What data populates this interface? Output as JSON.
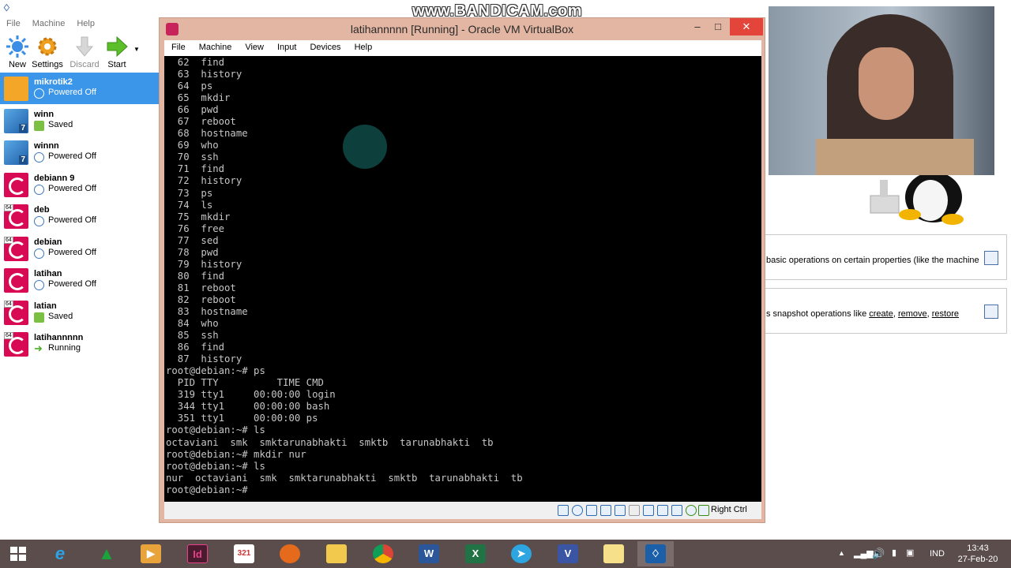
{
  "watermark": "www.BANDICAM.com",
  "manager": {
    "menu": [
      "File",
      "Machine",
      "Help"
    ],
    "toolbar": {
      "new": "New",
      "settings": "Settings",
      "discard": "Discard",
      "start": "Start"
    },
    "vms": [
      {
        "name": "mikrotik2",
        "state": "Powered Off",
        "os": "mikrotik",
        "selected": true
      },
      {
        "name": "winn",
        "state": "Saved",
        "os": "win7"
      },
      {
        "name": "winnn",
        "state": "Powered Off",
        "os": "win7"
      },
      {
        "name": "debiann 9",
        "state": "Powered Off",
        "os": "debian"
      },
      {
        "name": "deb",
        "state": "Powered Off",
        "os": "debian64"
      },
      {
        "name": "debian",
        "state": "Powered Off",
        "os": "debian64"
      },
      {
        "name": "latihan",
        "state": "Powered Off",
        "os": "debian"
      },
      {
        "name": "latian",
        "state": "Saved",
        "os": "debian64"
      },
      {
        "name": "latihannnnn",
        "state": "Running",
        "os": "debian64"
      }
    ],
    "details_pane": "basic operations on certain properties (like the machine",
    "snapshot_pane": {
      "prefix": "s snapshot operations like ",
      "create": "create",
      "sep1": ", ",
      "remove": "remove",
      "sep2": ", ",
      "restore": "restore"
    }
  },
  "vm_window": {
    "title": "latihannnnn [Running] - Oracle VM VirtualBox",
    "menu": [
      "File",
      "Machine",
      "View",
      "Input",
      "Devices",
      "Help"
    ],
    "terminal": "  62  find\n  63  history\n  64  ps\n  65  mkdir\n  66  pwd\n  67  reboot\n  68  hostname\n  69  who\n  70  ssh\n  71  find\n  72  history\n  73  ps\n  74  ls\n  75  mkdir\n  76  free\n  77  sed\n  78  pwd\n  79  history\n  80  find\n  81  reboot\n  82  reboot\n  83  hostname\n  84  who\n  85  ssh\n  86  find\n  87  history\nroot@debian:~# ps\n  PID TTY          TIME CMD\n  319 tty1     00:00:00 login\n  344 tty1     00:00:00 bash\n  351 tty1     00:00:00 ps\nroot@debian:~# ls\noctaviani  smk  smktarunabhakti  smktb  tarunabhakti  tb\nroot@debian:~# mkdir nur\nroot@debian:~# ls\nnur  octaviani  smk  smktarunabhakti  smktb  tarunabhakti  tb\nroot@debian:~# ",
    "host_key": "Right Ctrl"
  },
  "taskbar": {
    "apps": [
      "windows-start",
      "internet-explorer",
      "app-green-triangle",
      "media-player",
      "indesign",
      "calendar-app",
      "firefox",
      "file-explorer",
      "chrome",
      "word",
      "excel",
      "telegram",
      "visio",
      "folder",
      "virtualbox"
    ],
    "lang": "IND",
    "time": "13:43",
    "date": "27-Feb-20"
  },
  "colors": {
    "selection": "#3b95e8",
    "debian": "#d70a53",
    "taskbar": "#5a4d4c"
  }
}
